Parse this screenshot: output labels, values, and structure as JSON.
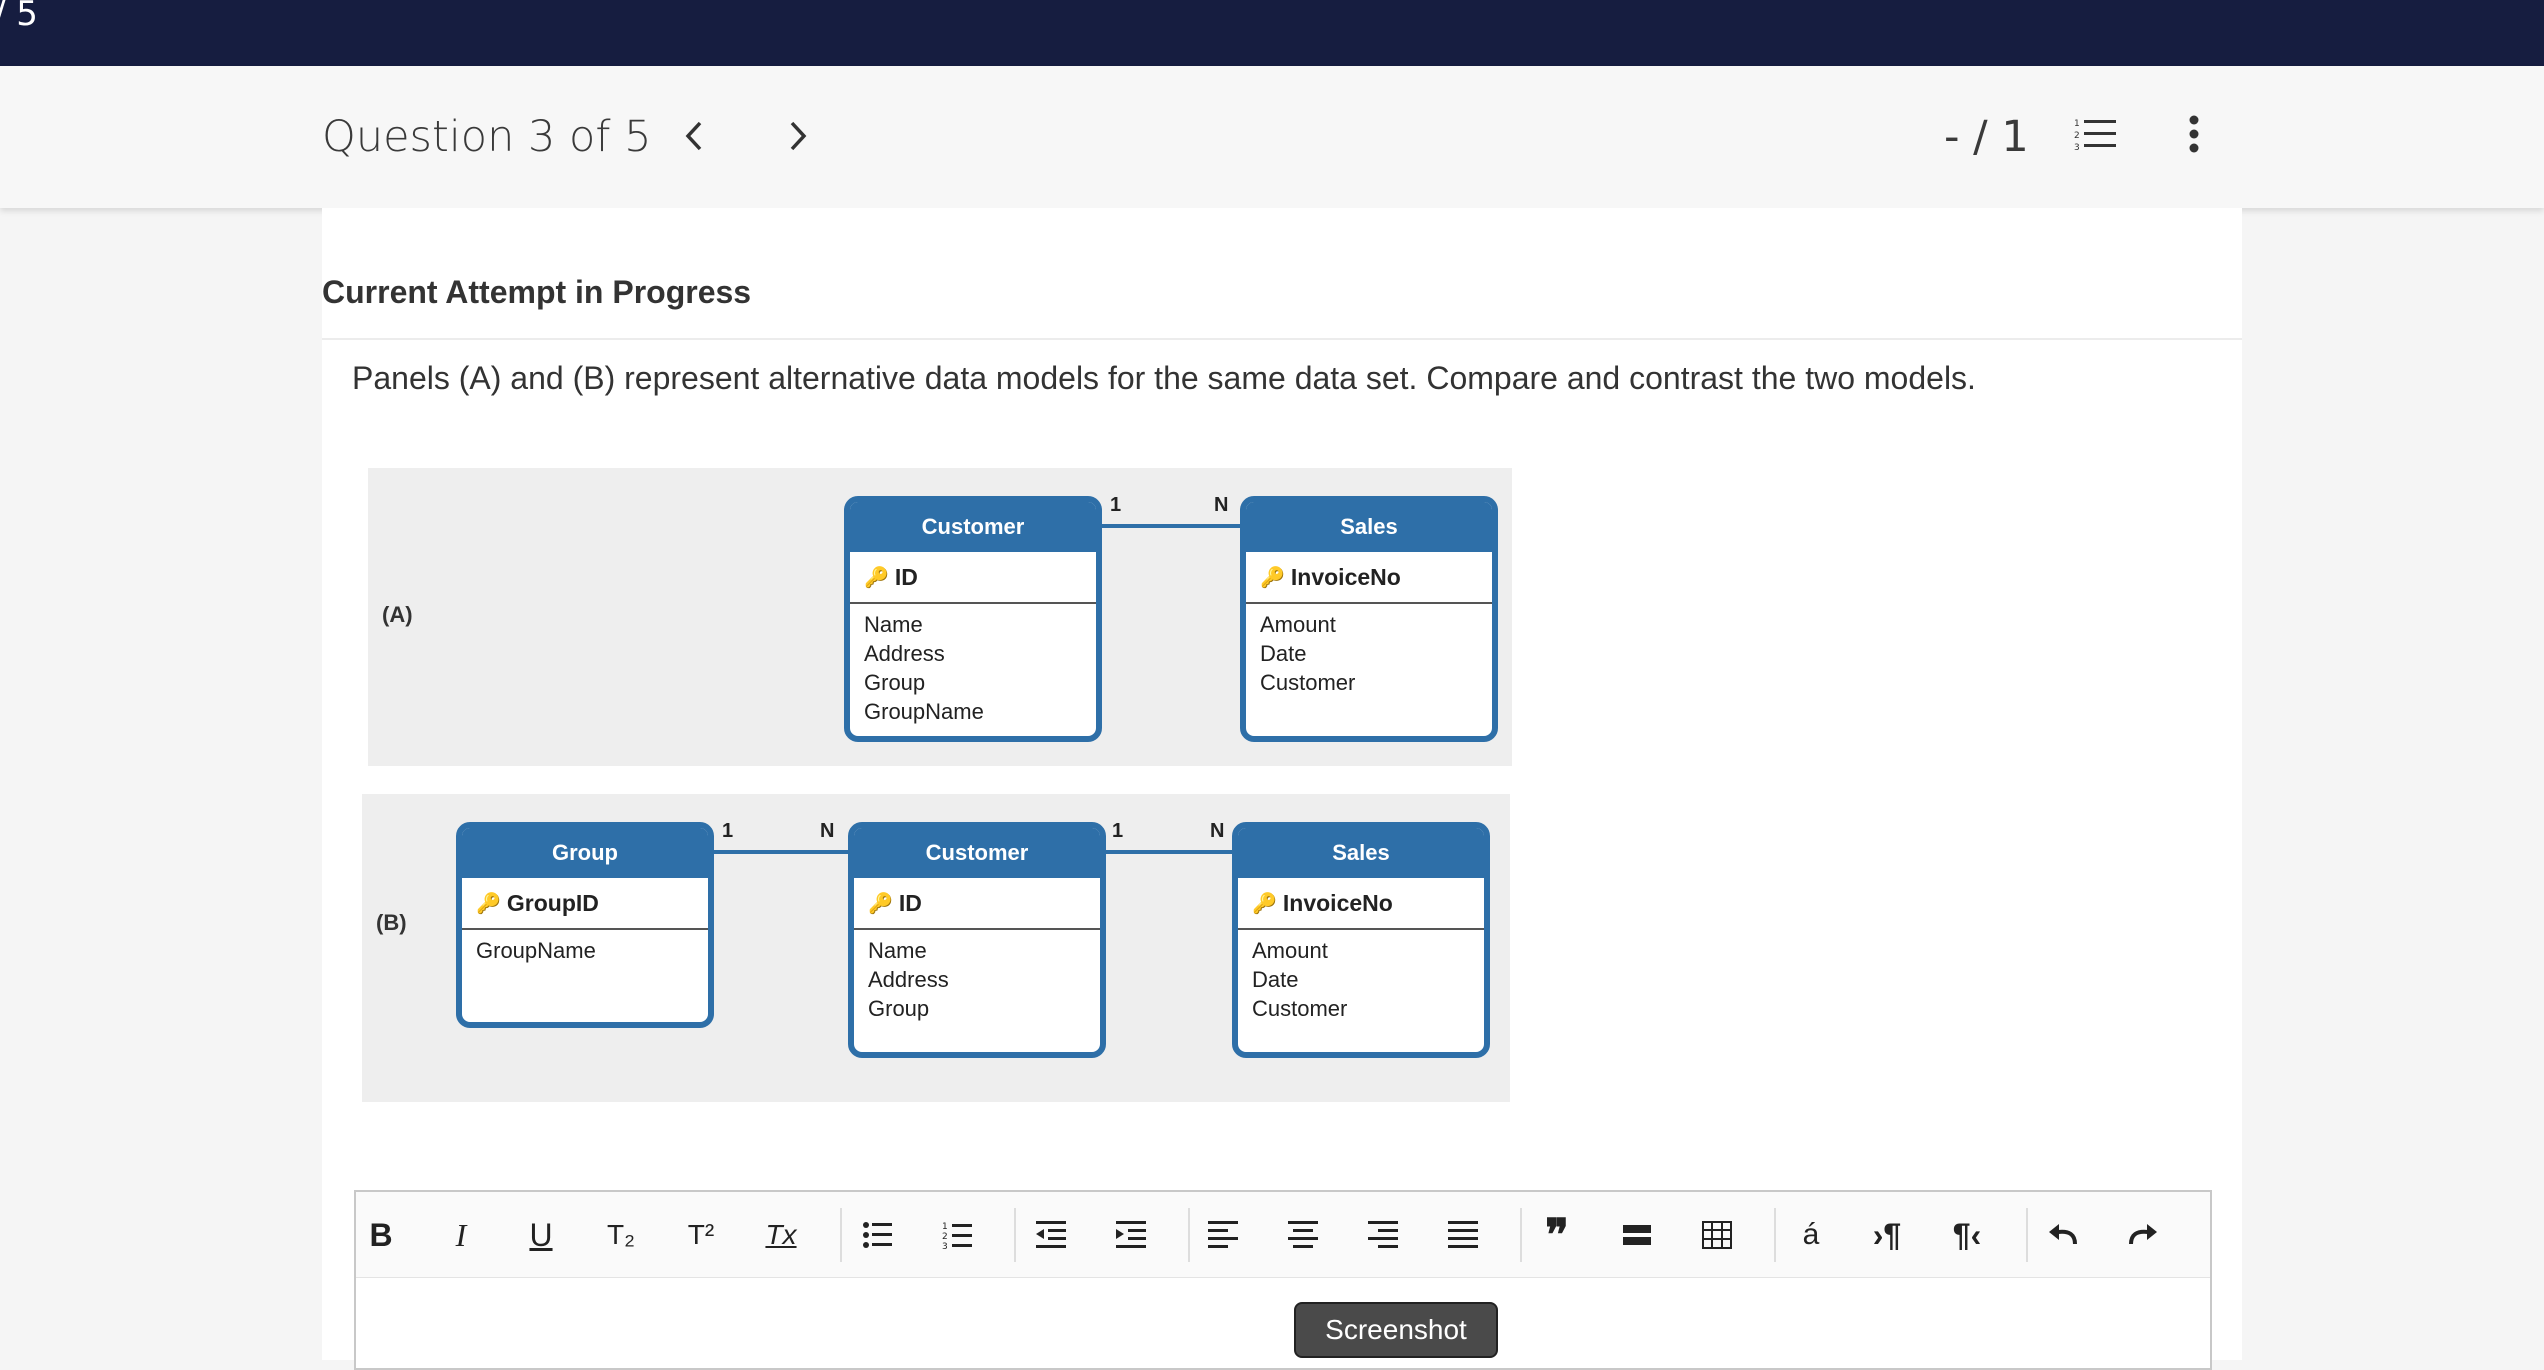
{
  "topbar": {
    "score": "/ 5"
  },
  "question_bar": {
    "title": "Question 3 of 5",
    "score": "- / 1"
  },
  "content": {
    "attempt_heading": "Current Attempt in Progress",
    "question_text": "Panels (A) and (B) represent alternative data models for the same data set. Compare and contrast the two models."
  },
  "diagram": {
    "panel_a": {
      "label": "(A)",
      "customer": {
        "title": "Customer",
        "key": "ID",
        "attrs": [
          "Name",
          "Address",
          "Group",
          "GroupName"
        ]
      },
      "sales": {
        "title": "Sales",
        "key": "InvoiceNo",
        "attrs": [
          "Amount",
          "Date",
          "Customer"
        ]
      },
      "rel": {
        "left": "1",
        "right": "N"
      }
    },
    "panel_b": {
      "label": "(B)",
      "group": {
        "title": "Group",
        "key": "GroupID",
        "attrs": [
          "GroupName"
        ]
      },
      "customer": {
        "title": "Customer",
        "key": "ID",
        "attrs": [
          "Name",
          "Address",
          "Group"
        ]
      },
      "sales": {
        "title": "Sales",
        "key": "InvoiceNo",
        "attrs": [
          "Amount",
          "Date",
          "Customer"
        ]
      },
      "rel1": {
        "left": "1",
        "right": "N"
      },
      "rel2": {
        "left": "1",
        "right": "N"
      }
    }
  },
  "editor": {
    "toolbar": {
      "bold": "B",
      "italic": "I",
      "underline": "U",
      "subscript": "T₂",
      "superscript": "T²",
      "clear_format": "Tx",
      "special_char": "á"
    }
  },
  "tooltip": {
    "text": "Screenshot"
  },
  "colors": {
    "topbar": "#161d40",
    "entity": "#2e6fa8"
  },
  "icons": [
    "chevron-left-icon",
    "chevron-right-icon",
    "list-icon",
    "more-vertical-icon"
  ]
}
